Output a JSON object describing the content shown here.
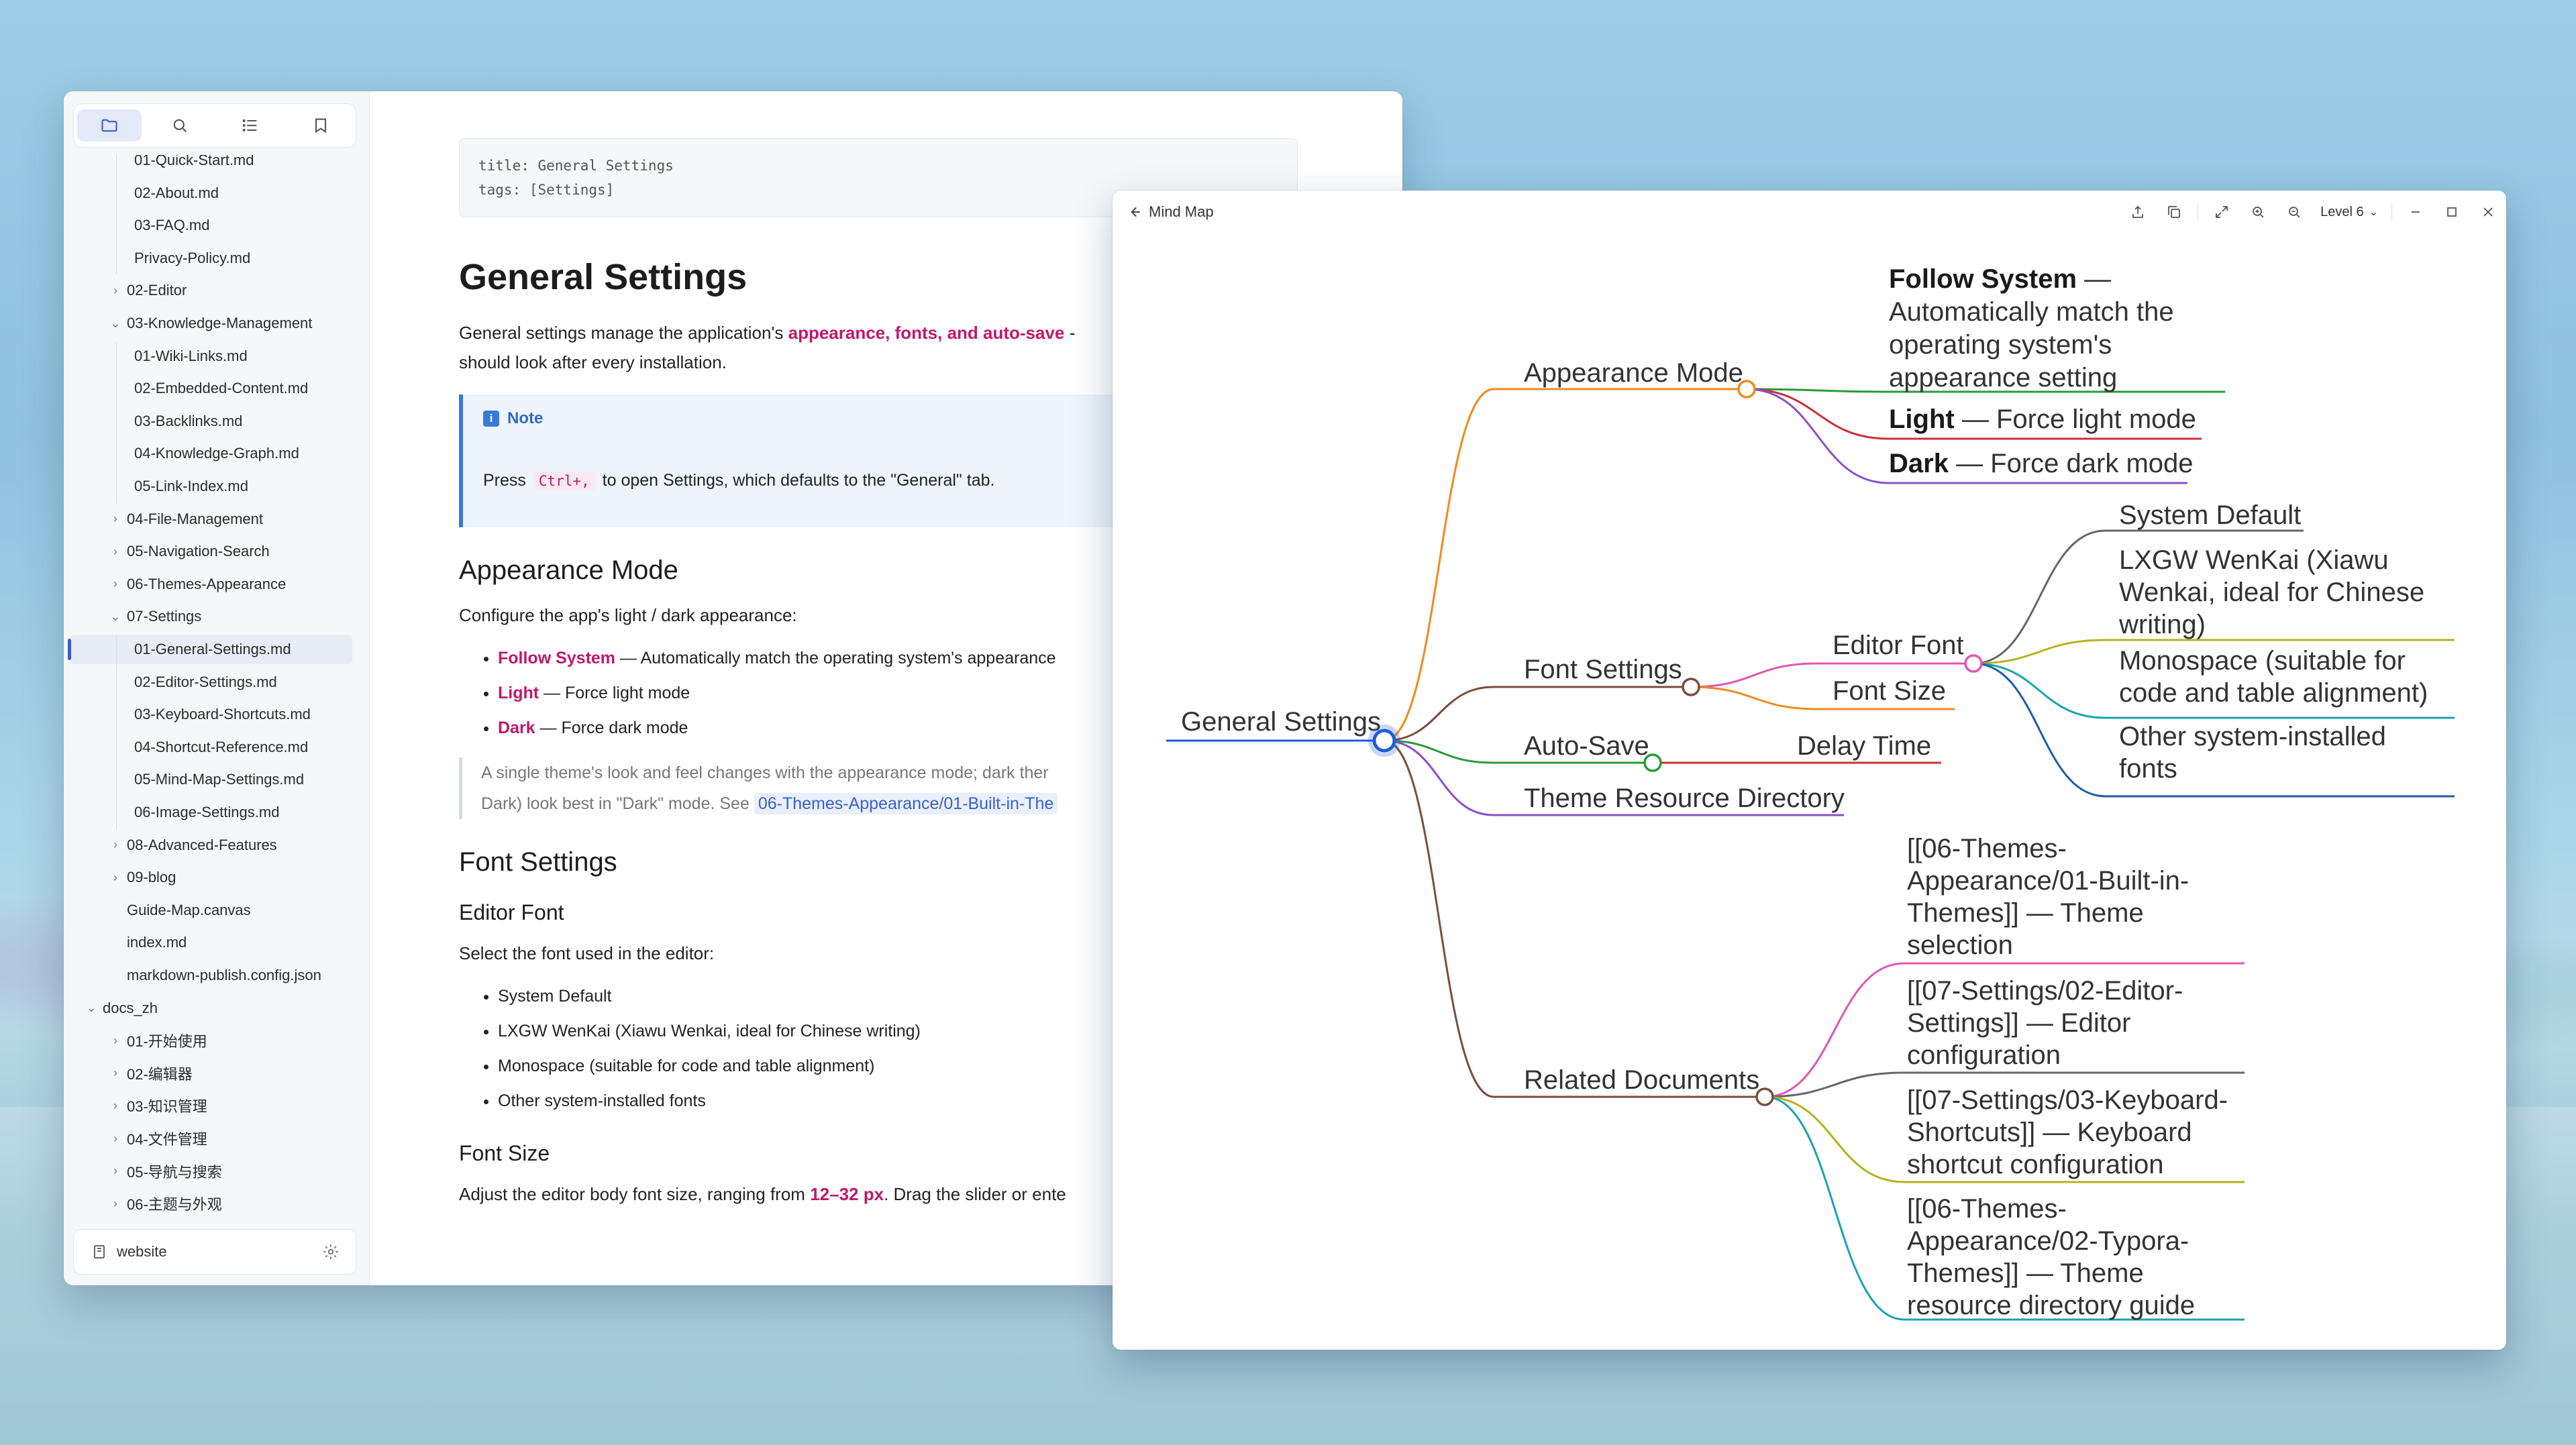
{
  "editor": {
    "sidebar": {
      "toolbar": [
        "folder-icon",
        "search-icon",
        "list-icon",
        "bookmark-icon"
      ],
      "tree": [
        {
          "label": "01-Quick-Start.md",
          "depth": 2
        },
        {
          "label": "02-About.md",
          "depth": 2
        },
        {
          "label": "03-FAQ.md",
          "depth": 2
        },
        {
          "label": "Privacy-Policy.md",
          "depth": 2
        },
        {
          "label": "02-Editor",
          "depth": 1,
          "chevron": "right"
        },
        {
          "label": "03-Knowledge-Management",
          "depth": 1,
          "chevron": "down"
        },
        {
          "label": "01-Wiki-Links.md",
          "depth": 2
        },
        {
          "label": "02-Embedded-Content.md",
          "depth": 2
        },
        {
          "label": "03-Backlinks.md",
          "depth": 2
        },
        {
          "label": "04-Knowledge-Graph.md",
          "depth": 2
        },
        {
          "label": "05-Link-Index.md",
          "depth": 2
        },
        {
          "label": "04-File-Management",
          "depth": 1,
          "chevron": "right"
        },
        {
          "label": "05-Navigation-Search",
          "depth": 1,
          "chevron": "right"
        },
        {
          "label": "06-Themes-Appearance",
          "depth": 1,
          "chevron": "right"
        },
        {
          "label": "07-Settings",
          "depth": 1,
          "chevron": "down"
        },
        {
          "label": "01-General-Settings.md",
          "depth": 2,
          "selected": true
        },
        {
          "label": "02-Editor-Settings.md",
          "depth": 2
        },
        {
          "label": "03-Keyboard-Shortcuts.md",
          "depth": 2
        },
        {
          "label": "04-Shortcut-Reference.md",
          "depth": 2
        },
        {
          "label": "05-Mind-Map-Settings.md",
          "depth": 2
        },
        {
          "label": "06-Image-Settings.md",
          "depth": 2
        },
        {
          "label": "08-Advanced-Features",
          "depth": 1,
          "chevron": "right"
        },
        {
          "label": "09-blog",
          "depth": 1,
          "chevron": "right"
        },
        {
          "label": "Guide-Map.canvas",
          "depth": 1
        },
        {
          "label": "index.md",
          "depth": 1
        },
        {
          "label": "markdown-publish.config.json",
          "depth": 1
        },
        {
          "label": "docs_zh",
          "depth": 0,
          "chevron": "down"
        },
        {
          "label": "01-开始使用",
          "depth": 1,
          "chevron": "right"
        },
        {
          "label": "02-编辑器",
          "depth": 1,
          "chevron": "right"
        },
        {
          "label": "03-知识管理",
          "depth": 1,
          "chevron": "right"
        },
        {
          "label": "04-文件管理",
          "depth": 1,
          "chevron": "right"
        },
        {
          "label": "05-导航与搜索",
          "depth": 1,
          "chevron": "right"
        },
        {
          "label": "06-主题与外观",
          "depth": 1,
          "chevron": "right"
        }
      ],
      "footer_label": "website"
    },
    "doc": {
      "frontmatter": [
        "title: General Settings",
        "tags: [Settings]"
      ],
      "h1": "General Settings",
      "intro_pre": "General settings manage the application's ",
      "intro_hl": "appearance, fonts, and auto-save",
      "intro_post": " -",
      "intro_line2": "should look after every installation.",
      "note_title": "Note",
      "note_pre": "Press ",
      "note_kbd": "Ctrl+,",
      "note_post": " to open Settings, which defaults to the \"General\" tab.",
      "h2_appearance": "Appearance Mode",
      "appearance_intro": "Configure the app's light / dark appearance:",
      "appearance_items": [
        {
          "hl": "Follow System",
          "rest": " — Automatically match the operating system's appearance"
        },
        {
          "hl": "Light",
          "rest": " — Force light mode"
        },
        {
          "hl": "Dark",
          "rest": " — Force dark mode"
        }
      ],
      "quote_line1": "A single theme's look and feel changes with the appearance mode; dark ther",
      "quote_line2_pre": "Dark) look best in \"Dark\" mode. See ",
      "quote_link": "06-Themes-Appearance/01-Built-in-The",
      "h2_font": "Font Settings",
      "h3_editor_font": "Editor Font",
      "editor_font_intro": "Select the font used in the editor:",
      "font_items": [
        "System Default",
        "LXGW WenKai (Xiawu Wenkai, ideal for Chinese writing)",
        "Monospace (suitable for code and table alignment)",
        "Other system-installed fonts"
      ],
      "h3_font_size": "Font Size",
      "font_size_pre": "Adjust the editor body font size, ranging from ",
      "font_size_hl": "12–32 px",
      "font_size_post": ". Drag the slider or ente"
    }
  },
  "mindmap": {
    "title": "Mind Map",
    "level_label": "Level 6",
    "root": "General Settings",
    "appearance": {
      "label": "Appearance Mode",
      "follow_bold": "Follow System",
      "follow_lines": [
        " —",
        "Automatically match the",
        "operating system's",
        "appearance setting"
      ],
      "light_bold": "Light",
      "light_rest": " — Force light mode",
      "dark_bold": "Dark",
      "dark_rest": " — Force dark mode"
    },
    "font": {
      "label": "Font Settings",
      "editor_font": "Editor Font",
      "font_size": "Font Size",
      "options": [
        [
          "System Default"
        ],
        [
          "LXGW WenKai (Xiawu",
          "Wenkai, ideal for Chinese",
          "writing)"
        ],
        [
          "Monospace (suitable for",
          "code and table alignment)"
        ],
        [
          "Other system-installed",
          "fonts"
        ]
      ]
    },
    "autosave": {
      "label": "Auto-Save",
      "delay": "Delay Time"
    },
    "theme_dir": "Theme Resource Directory",
    "related": {
      "label": "Related Documents",
      "docs": [
        [
          "[[06-Themes-",
          "Appearance/01-Built-in-",
          "Themes]] — Theme",
          "selection"
        ],
        [
          "[[07-Settings/02-Editor-",
          "Settings]] — Editor",
          "configuration"
        ],
        [
          "[[07-Settings/03-Keyboard-",
          "Shortcuts]] — Keyboard",
          "shortcut configuration"
        ],
        [
          "[[06-Themes-",
          "Appearance/02-Typora-",
          "Themes]] — Theme",
          "resource directory guide"
        ]
      ]
    },
    "colors": {
      "root": "#1f5bd6",
      "appearance": "#f08a1c",
      "font": "#7b4d3e",
      "autosave": "#2a9a3a",
      "theme": "#8a4fc9",
      "related": "#7b4d3e",
      "green": "#2a9a3a",
      "red": "#c8323a",
      "purple": "#8a4fc9",
      "pink": "#e255b2",
      "orange": "#f08a1c",
      "gray": "#666666",
      "olive": "#b5b21c",
      "teal": "#1aa3b0",
      "navy": "#1f5ba6"
    }
  }
}
